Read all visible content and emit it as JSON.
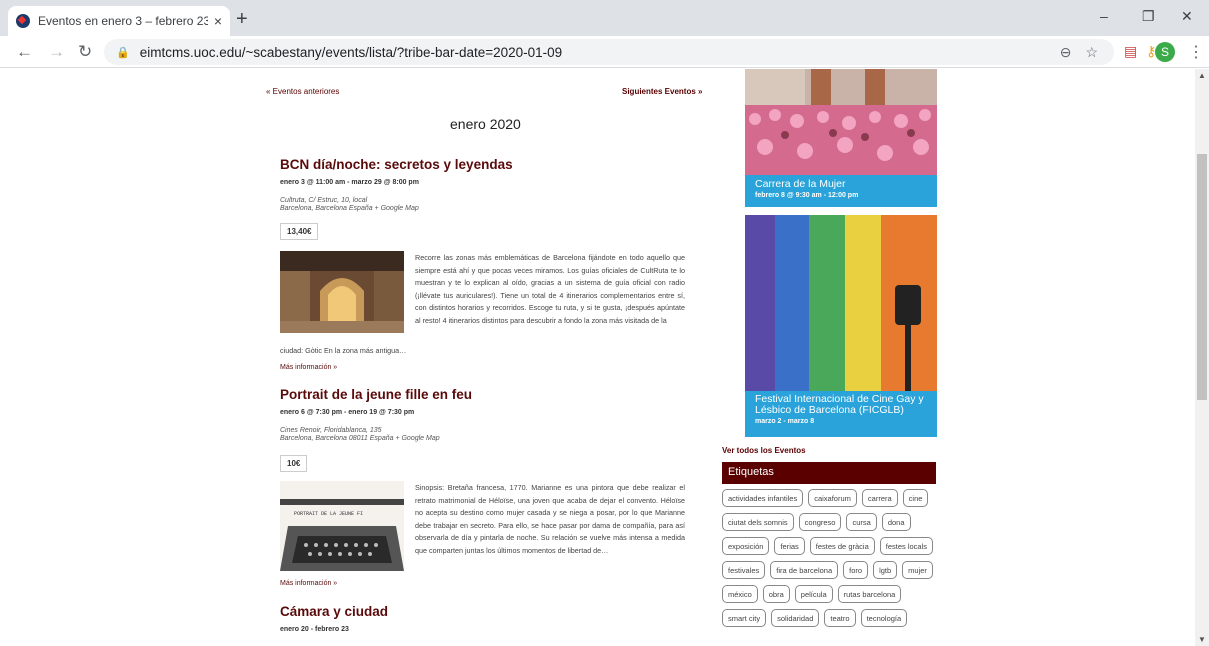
{
  "browser": {
    "tab_title": "Eventos en enero 3 – febrero 23 ·",
    "tab_close": "×",
    "new_tab": "+",
    "url": "eimtcms.uoc.edu/~scabestany/events/lista/?tribe-bar-date=2020-01-09",
    "avatar_letter": "S",
    "win_min": "–",
    "win_restore": "❐",
    "win_close": "✕",
    "icons": [
      "back-icon",
      "forward-icon",
      "reload-icon",
      "lock-icon",
      "zoom-icon",
      "star-icon",
      "pdf-extension-icon",
      "key-extension-icon",
      "menu-icon"
    ]
  },
  "page": {
    "prev_events": "« Eventos anteriores",
    "next_events": "Siguientes Eventos »",
    "month_heading": "enero 2020",
    "events": [
      {
        "title": "BCN día/noche: secretos y leyendas",
        "date": "enero 3 @ 11:00 am - marzo 29 @ 8:00 pm",
        "venue_line1": "Cultruta, C/ Estruc, 10, local",
        "venue_line2": "Barcelona, Barcelona España + Google Map",
        "price": "13,40€",
        "desc": "Recorre las zonas más emblemáticas de Barcelona fijándote en todo aquello que siempre está ahí y que pocas veces miramos. Los guías oficiales de CultRuta te lo muestran y te lo explican al oído, gracias a un sistema de guía oficial con radio (¡llévate tus auriculares!). Tiene un total de 4 itinerarios complementarios entre sí, con distintos horarios y recorridos. Escoge tu ruta, y si te gusta, ¡después apúntate al resto! 4 itinerarios distintos para descubrir a fondo la zona más visitada de la",
        "tail": "ciudad: Gòtic En la zona más antigua…",
        "more": "Más información »"
      },
      {
        "title": "Portrait de la jeune fille en feu",
        "date": "enero 6 @ 7:30 pm - enero 19 @ 7:30 pm",
        "venue_line1": "Cines Renoir, Floridablanca, 135",
        "venue_line2": "Barcelona, Barcelona 08011 España + Google Map",
        "price": "10€",
        "desc": "Sinopsis: Bretaña francesa, 1770. Marianne es una pintora que debe realizar el retrato matrimonial de Héloïse, una joven que acaba de dejar el convento. Héloïse no acepta su destino como mujer casada y se niega a posar, por lo que Marianne debe trabajar en secreto. Para ello, se hace pasar por dama de compañía, para así observarla de día y pintarla de noche. Su relación se vuelve más intensa a medida que comparten juntas los últimos momentos de libertad de…",
        "img_text": "PORTRAIT DE LA JEUNE FI",
        "more": "Más información »"
      },
      {
        "title": "Cámara y ciudad",
        "date": "enero 20 - febrero 23"
      }
    ]
  },
  "sidebar": {
    "card1_title": "Carrera de la Mujer",
    "card1_date": "febrero 8 @ 9:30 am - 12:00 pm",
    "card2_title": "Festival Internacional de Cine Gay y Lésbico de Barcelona (FICGLB)",
    "card2_date": "marzo 2 - marzo 8",
    "see_all": "Ver todos los Eventos",
    "etiquetas_heading": "Etiquetas",
    "tags": [
      "actividades infantiles",
      "caixaforum",
      "carrera",
      "cine",
      "ciutat dels somnis",
      "congreso",
      "cursa",
      "dona",
      "exposición",
      "ferias",
      "festes de gràcia",
      "festes locals",
      "festivales",
      "fira de barcelona",
      "foro",
      "lgtb",
      "mujer",
      "méxico",
      "obra",
      "película",
      "rutas barcelona",
      "smart city",
      "solidaridad",
      "teatro",
      "tecnología"
    ]
  },
  "colors": {
    "accent": "#5a0000",
    "card": "#29a3d9"
  }
}
